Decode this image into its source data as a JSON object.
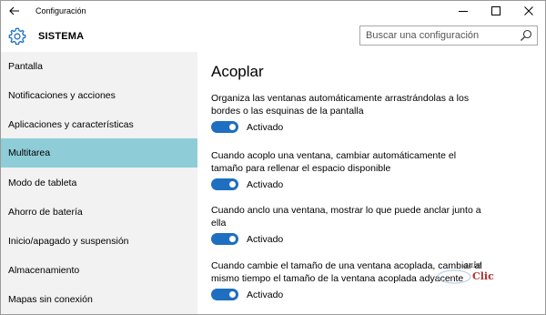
{
  "window": {
    "title": "Configuración",
    "controls": [
      "minimize",
      "maximize",
      "close"
    ]
  },
  "header": {
    "icon": "gear-icon",
    "title": "SISTEMA",
    "search_placeholder": "Buscar una configuración"
  },
  "sidebar": {
    "items": [
      {
        "label": "Pantalla",
        "selected": false
      },
      {
        "label": "Notificaciones y acciones",
        "selected": false
      },
      {
        "label": "Aplicaciones y características",
        "selected": false
      },
      {
        "label": "Multitarea",
        "selected": true
      },
      {
        "label": "Modo de tableta",
        "selected": false
      },
      {
        "label": "Ahorro de batería",
        "selected": false
      },
      {
        "label": "Inicio/apagado y suspensión",
        "selected": false
      },
      {
        "label": "Almacenamiento",
        "selected": false
      },
      {
        "label": "Mapas sin conexión",
        "selected": false
      }
    ],
    "selected_color": "#8ecdd8"
  },
  "main": {
    "title": "Acoplar",
    "settings": [
      {
        "description": "Organiza las ventanas automáticamente arrastrándolas a los bordes o las esquinas de la pantalla",
        "state": "Activado",
        "on": true
      },
      {
        "description": "Cuando acoplo una ventana, cambiar automáticamente el tamaño para rellenar el espacio disponible",
        "state": "Activado",
        "on": true
      },
      {
        "description": "Cuando anclo una ventana, mostrar lo que puede anclar junto a ella",
        "state": "Activado",
        "on": true
      },
      {
        "description": "Cuando cambie el tamaño de una ventana acoplada, cambiar al mismo tiempo el tamaño de la ventana acoplada adyacente",
        "state": "Activado",
        "on": true
      }
    ],
    "toggle_color": "#1e6fbf"
  },
  "watermark": {
    "line1": "aula",
    "line2": "Clic"
  }
}
